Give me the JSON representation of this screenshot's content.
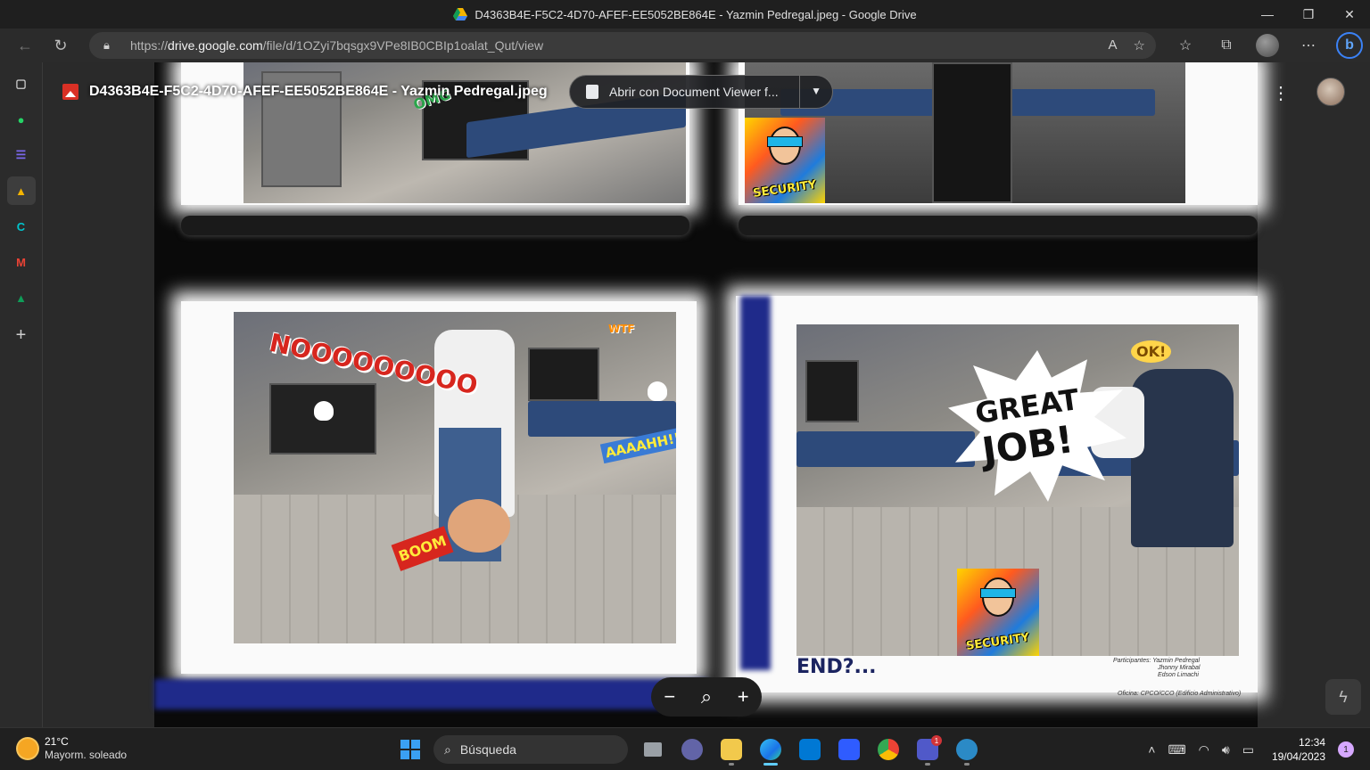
{
  "window": {
    "title": "D4363B4E-F5C2-4D70-AFEF-EE5052BE864E - Yazmin Pedregal.jpeg - Google Drive",
    "controls": {
      "minimize": "—",
      "restore": "❐",
      "close": "✕"
    }
  },
  "address_bar": {
    "url_prefix": "https://",
    "url_host": "drive.google.com",
    "url_path": "/file/d/1OZyi7bqsgx9VPe8IB0CBIp1oalat_Qut/view"
  },
  "edge_sidebar": {
    "items": [
      {
        "name": "tabs",
        "glyph": "▢",
        "color": "#cfcfcf"
      },
      {
        "name": "whatsapp",
        "glyph": "●",
        "color": "#25d366"
      },
      {
        "name": "list-app",
        "glyph": "☰",
        "color": "#7b68ee"
      },
      {
        "name": "google-drive",
        "glyph": "▲",
        "color": "#f4b400"
      },
      {
        "name": "canva",
        "glyph": "C",
        "color": "#00c4cc"
      },
      {
        "name": "gmail",
        "glyph": "M",
        "color": "#ea4335"
      },
      {
        "name": "google-drive-2",
        "glyph": "▲",
        "color": "#0f9d58"
      },
      {
        "name": "add",
        "glyph": "+",
        "color": "#cfcfcf"
      }
    ]
  },
  "viewer": {
    "file_name": "D4363B4E-F5C2-4D70-AFEF-EE5052BE864E - Yazmin Pedregal.jpeg",
    "open_with_label": "Abrir con Document Viewer f...",
    "more_icon": "⋮"
  },
  "comic": {
    "sfx_nooo": "NOOOOOOOOO",
    "sfx_omg": "OMG",
    "sfx_wtf": "WTF",
    "sfx_boom": "BOOM",
    "sfx_aaah": "AAAAHH!!!",
    "sfx_ok": "OK!",
    "great_job_line1": "GREAT",
    "great_job_line2": "JOB!",
    "hero_badge": "SECURITY",
    "end_text": "END?...",
    "credits_label": "Participantes:",
    "credits_names": [
      "Yazmin Pedregal",
      "Jhonny Mirabal",
      "Edson Limachi"
    ],
    "office_label": "Oficina:",
    "office_value": "CPCO/CCO (Edificio Administrativo)"
  },
  "zoom_controls": {
    "minus": "−",
    "zoom_icon": "⌕",
    "plus": "+"
  },
  "taskbar": {
    "weather_temp": "21°C",
    "weather_desc": "Mayorm. soleado",
    "search_placeholder": "Búsqueda",
    "apps": [
      {
        "name": "task-view",
        "color": "#9aa0a6"
      },
      {
        "name": "teams-chat",
        "color": "#6264a7"
      },
      {
        "name": "file-explorer",
        "color": "#f2c94c"
      },
      {
        "name": "edge",
        "color": "#1fa7e0",
        "active": true
      },
      {
        "name": "microsoft-store",
        "color": "#0078d4"
      },
      {
        "name": "power-automate",
        "color": "#2f5cff"
      },
      {
        "name": "chrome",
        "color": "#34a853"
      },
      {
        "name": "teams",
        "color": "#5059c9",
        "badge": "1"
      },
      {
        "name": "vpn-client",
        "color": "#2b8ac6"
      }
    ],
    "time": "12:34",
    "date": "19/04/2023",
    "notification_count": "1"
  }
}
